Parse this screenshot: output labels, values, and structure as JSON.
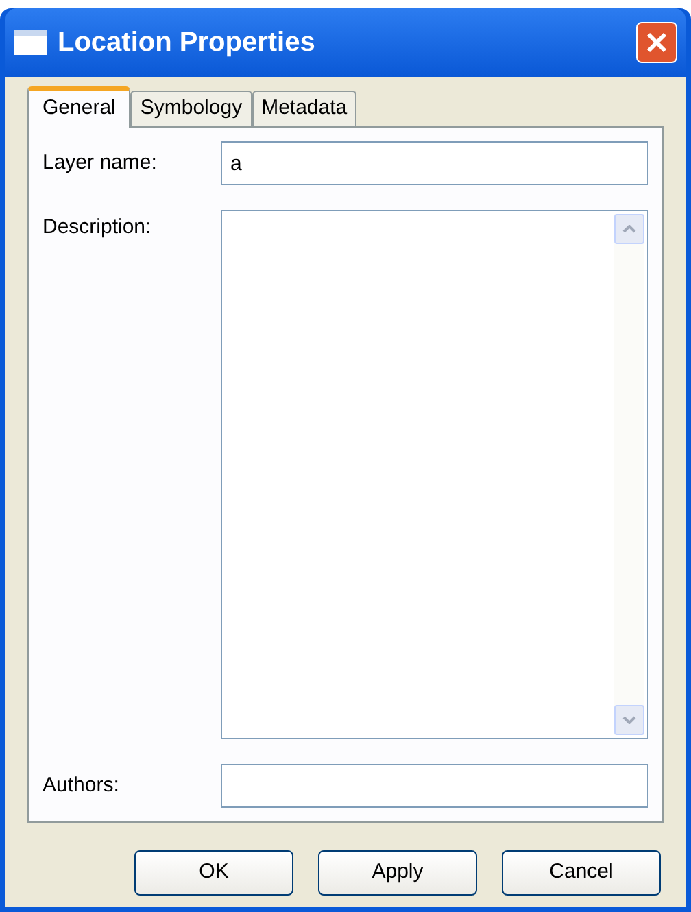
{
  "window": {
    "title": "Location Properties"
  },
  "tabs": [
    {
      "label": "General",
      "selected": true
    },
    {
      "label": "Symbology",
      "selected": false
    },
    {
      "label": "Metadata",
      "selected": false
    }
  ],
  "fields": [
    {
      "kind": "line",
      "label": "Layer name:",
      "value": "a"
    },
    {
      "kind": "area",
      "label": "Description:"
    },
    {
      "kind": "line",
      "label": "Authors:"
    }
  ],
  "buttons": [
    "OK",
    "Apply",
    "Cancel"
  ]
}
